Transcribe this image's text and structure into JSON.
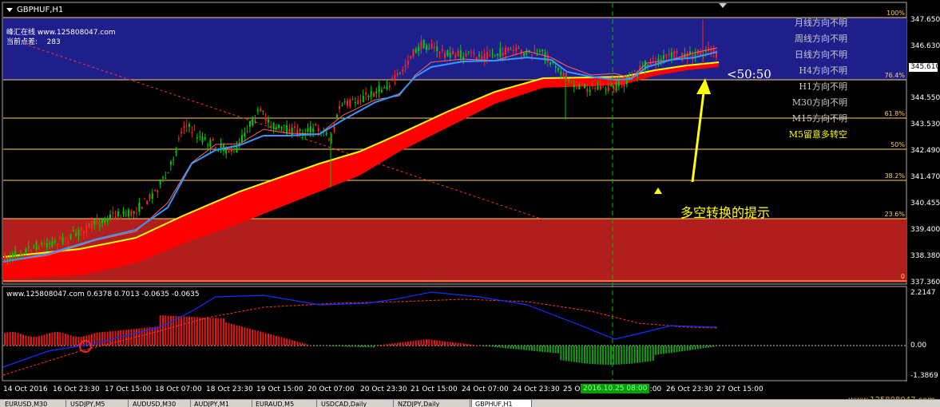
{
  "chart": {
    "symbol_label": "GBPHUF,H1",
    "site_line": "峰汇在线 www.125808047.com",
    "points_label": "当前点差:",
    "points_value": "283",
    "current_price": "345.610"
  },
  "trend_notes": [
    "月线方向不明",
    "周线方向不明",
    "日线方向不明",
    "H4方向不明",
    "H1方向不明",
    "M30方向不明",
    "M15方向不明",
    "M5留意多转空"
  ],
  "ratio_label": "<50:50",
  "hint_text": "多空转换的提示",
  "fib_levels": [
    "100%",
    "76.4%",
    "61.8%",
    "50%",
    "38.2%",
    "23.6%",
    "0"
  ],
  "price_scale": [
    "347.650",
    "346.630",
    "345.610",
    "344.550",
    "343.530",
    "342.490",
    "341.470",
    "340.455",
    "339.400",
    "338.380",
    "337.360"
  ],
  "oscillator": {
    "title": "www.125808047.com 0.6378 0.7013 -0.0635 -0.0635",
    "scale": [
      "2.2147",
      "0.00",
      "-1.3869"
    ]
  },
  "time_axis": [
    "14 Oct 2016",
    "16 Oct 23:30",
    "17 Oct 15:00",
    "18 Oct 07:00",
    "18 Oct 23:30",
    "19 Oct 15:00",
    "20 Oct 07:00",
    "20 Oct 23:30",
    "21 Oct 15:00",
    "24 Oct 07:00",
    "24 Oct 23:30",
    "25 O",
    "7:00",
    "26 Oct 23:30",
    "27 Oct 15:00"
  ],
  "crosshair_time": "2016.10.25 08:00",
  "watermark": "www.125808047.com",
  "tabs": [
    "EURUSD,M30",
    "USDJPY,M5",
    "AUDUSD,M30",
    "AUDJPY,M1",
    "EURAUD,M5",
    "USDCAD,Daily",
    "NZDJPY,Daily",
    "GBPHUF,H1"
  ],
  "colors": {
    "zone_upper": "#1f1f8c",
    "zone_lower": "#b01e1e",
    "ribbon": "#ff0000",
    "ma_yellow": "#ffff00",
    "ma_blue": "#3399ff",
    "bull_candle": "#00cc00",
    "bear_candle": "#ff2020",
    "fib_line": "#ffd060",
    "hint_arrow": "#ffff00"
  }
}
